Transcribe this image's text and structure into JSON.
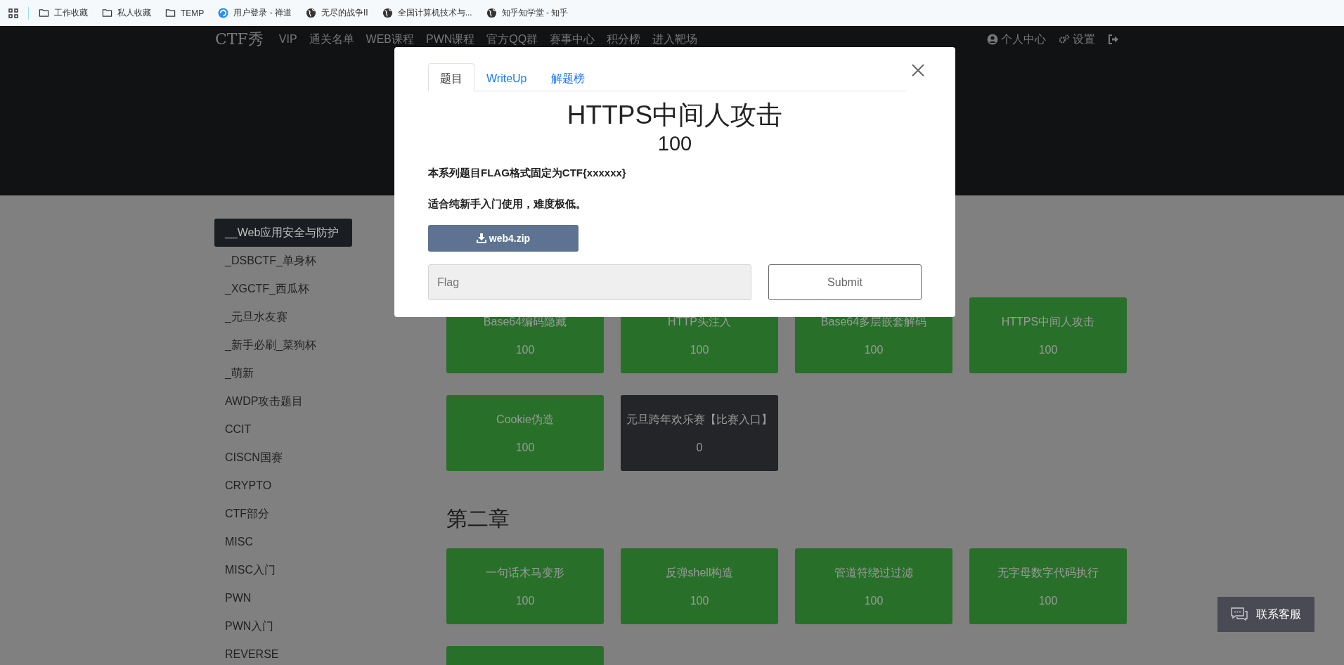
{
  "bookmarks": [
    {
      "label": "工作收藏",
      "kind": "folder"
    },
    {
      "label": "私人收藏",
      "kind": "folder"
    },
    {
      "label": "TEMP",
      "kind": "folder"
    },
    {
      "label": "用户登录 - 禅道",
      "kind": "swirl"
    },
    {
      "label": "无尽的战争II",
      "kind": "globe"
    },
    {
      "label": "全国计算机技术与...",
      "kind": "globe"
    },
    {
      "label": "知乎知学堂 - 知乎",
      "kind": "globe"
    }
  ],
  "navbar": {
    "logo": "CTF秀",
    "links": [
      "VIP",
      "通关名单",
      "WEB课程",
      "PWN课程",
      "官方QQ群",
      "赛事中心",
      "积分榜",
      "进入靶场"
    ],
    "right": [
      {
        "kind": "user",
        "label": "个人中心"
      },
      {
        "kind": "gear",
        "label": "设置"
      },
      {
        "kind": "logout"
      }
    ]
  },
  "sidebar": {
    "items": [
      {
        "label": "__Web应用安全与防护",
        "selected": true
      },
      {
        "label": "_DSBCTF_单身杯",
        "selected": false
      },
      {
        "label": "_XGCTF_西瓜杯",
        "selected": false
      },
      {
        "label": "_元旦水友赛",
        "selected": false
      },
      {
        "label": "_新手必刷_菜狗杯",
        "selected": false
      },
      {
        "label": "_萌新",
        "selected": false
      },
      {
        "label": "AWDP攻击题目",
        "selected": false
      },
      {
        "label": "CCIT",
        "selected": false
      },
      {
        "label": "CISCN国赛",
        "selected": false
      },
      {
        "label": "CRYPTO",
        "selected": false
      },
      {
        "label": "CTF部分",
        "selected": false
      },
      {
        "label": "MISC",
        "selected": false
      },
      {
        "label": "MISC入门",
        "selected": false
      },
      {
        "label": "PWN",
        "selected": false
      },
      {
        "label": "PWN入门",
        "selected": false
      },
      {
        "label": "REVERSE",
        "selected": false
      }
    ]
  },
  "sections": [
    {
      "cards": [
        {
          "title": "Base64编码隐藏",
          "score": "100",
          "color": "#287029"
        },
        {
          "title": "HTTP头注入",
          "score": "100",
          "color": "#287029"
        },
        {
          "title": "Base64多层嵌套解码",
          "score": "100",
          "color": "#287029"
        },
        {
          "title": "HTTPS中间人攻击",
          "score": "100",
          "color": "#287029"
        },
        {
          "title": "Cookie伪造",
          "score": "100",
          "color": "#287029"
        },
        {
          "title": "元旦跨年欢乐赛【比赛入口】",
          "score": "0",
          "color": "#242528"
        }
      ]
    },
    {
      "title": "第二章",
      "cards": [
        {
          "title": "一句话木马变形",
          "score": "100",
          "color": "#287029"
        },
        {
          "title": "反弹shell构造",
          "score": "100",
          "color": "#287029"
        },
        {
          "title": "管道符绕过过滤",
          "score": "100",
          "color": "#287029"
        },
        {
          "title": "无字母数字代码执行",
          "score": "100",
          "color": "#287029"
        },
        {
          "color": "#287029"
        }
      ]
    }
  ],
  "modal": {
    "tabs": [
      {
        "label": "题目",
        "selected": true
      },
      {
        "label": "WriteUp",
        "selected": false
      },
      {
        "label": "解题榜",
        "selected": false
      }
    ],
    "title": "HTTPS中间人攻击",
    "score": "100",
    "lines": [
      "本系列题目FLAG格式固定为CTF{xxxxxx}",
      "适合纯新手入门使用，难度极低。"
    ],
    "download": "web4.zip",
    "flag_placeholder": "Flag",
    "submit": "Submit"
  },
  "chat": {
    "label": "联系客服"
  }
}
